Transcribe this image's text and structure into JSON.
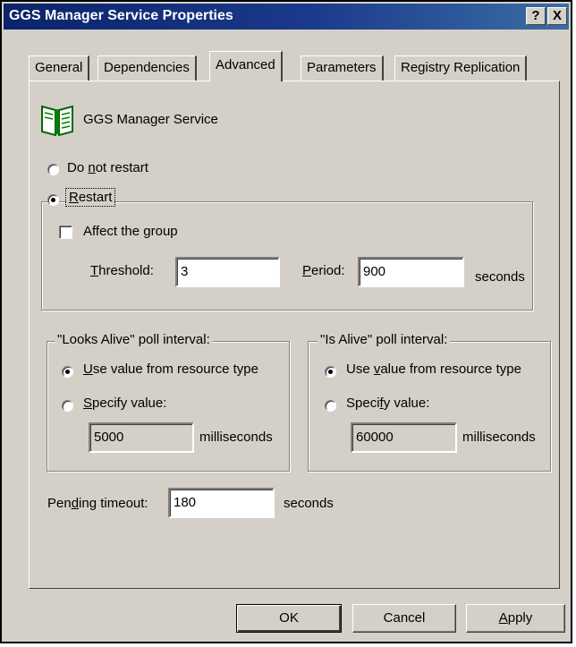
{
  "window": {
    "title": "GGS Manager Service Properties",
    "help_label": "?",
    "close_label": "X"
  },
  "tabs": [
    {
      "label": "General",
      "active": false
    },
    {
      "label": "Dependencies",
      "active": false
    },
    {
      "label": "Advanced",
      "active": true
    },
    {
      "label": "Parameters",
      "active": false
    },
    {
      "label": "Registry Replication",
      "active": false
    }
  ],
  "resource": {
    "icon": "book-icon",
    "name": "GGS Manager Service"
  },
  "restart_policy": {
    "do_not_restart": {
      "pre": "Do ",
      "key": "n",
      "post": "ot restart",
      "selected": false
    },
    "restart": {
      "pre": "",
      "key": "R",
      "post": "estart",
      "selected": true
    },
    "affect_group": {
      "pre": "",
      "key": "",
      "post": "Affect the group",
      "checked": false
    },
    "threshold": {
      "label_key": "T",
      "label_rest": "hreshold:",
      "value": "3"
    },
    "period": {
      "label_key": "P",
      "label_rest": "eriod:",
      "value": "900",
      "unit": "seconds"
    }
  },
  "looks_alive": {
    "title": "\"Looks Alive\" poll interval:",
    "use_default": {
      "key": "U",
      "rest": "se value from resource type",
      "selected": true
    },
    "specify": {
      "key": "S",
      "rest": "pecify value:",
      "selected": false
    },
    "value": "5000",
    "unit": "milliseconds"
  },
  "is_alive": {
    "title": "\"Is Alive\" poll interval:",
    "use_default": {
      "pre": "Use ",
      "key": "v",
      "post": "alue from resource type",
      "selected": true
    },
    "specify": {
      "pre": "Speci",
      "key": "f",
      "post": "y value:",
      "selected": false
    },
    "value": "60000",
    "unit": "milliseconds"
  },
  "pending_timeout": {
    "label_pre": "Pen",
    "label_key": "d",
    "label_post": "ing timeout:",
    "value": "180",
    "unit": "seconds"
  },
  "buttons": {
    "ok": "OK",
    "cancel": "Cancel",
    "apply_key": "A",
    "apply_rest": "pply"
  }
}
